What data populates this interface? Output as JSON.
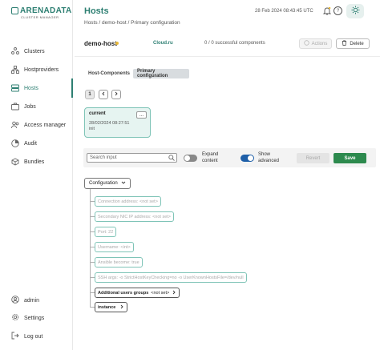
{
  "brand": {
    "name": "ARENADATA",
    "subtitle": "CLUSTER MANAGER"
  },
  "sidebar": {
    "items": [
      {
        "label": "Clusters",
        "icon": "clusters-icon"
      },
      {
        "label": "Hostproviders",
        "icon": "hostproviders-icon"
      },
      {
        "label": "Hosts",
        "icon": "hosts-icon"
      },
      {
        "label": "Jobs",
        "icon": "jobs-icon"
      },
      {
        "label": "Access manager",
        "icon": "access-manager-icon"
      },
      {
        "label": "Audit",
        "icon": "audit-icon"
      },
      {
        "label": "Bundles",
        "icon": "bundles-icon"
      }
    ],
    "bottom": [
      {
        "label": "admin",
        "icon": "user-icon"
      },
      {
        "label": "Settings",
        "icon": "settings-icon"
      },
      {
        "label": "Log out",
        "icon": "logout-icon"
      }
    ]
  },
  "header": {
    "title": "Hosts",
    "breadcrumb": "Hosts / demo-host / Primary configuration",
    "datetime": "28 Feb 2024  08:43:45  UTC"
  },
  "host": {
    "name": "demo-host",
    "cluster": "Cloud.ru",
    "components": "0 / 0 successful components",
    "actions_label": "Actions",
    "delete_label": "Delete"
  },
  "tabs": [
    {
      "label": "Host-Components"
    },
    {
      "label": "Primary configuration"
    }
  ],
  "pagination": {
    "current": "1"
  },
  "config": {
    "label": "current",
    "date": "28/02/2024 08:27:51",
    "description": "init",
    "more": "..."
  },
  "toolbar": {
    "search_placeholder": "Search input",
    "expand_label_1": "Expand",
    "expand_label_2": "content",
    "advanced_label_1": "Show",
    "advanced_label_2": "advanced",
    "revert_label": "Revert",
    "save_label": "Save"
  },
  "tree": {
    "root_label": "Configuration",
    "items": [
      {
        "text": "Connection address: <not set>"
      },
      {
        "text": "Secondary NIC IP address: <not set>"
      },
      {
        "text": "Port: 22"
      },
      {
        "text": "Username: <int>"
      },
      {
        "text": "Ansible become: true"
      },
      {
        "text": "SSH args: -o StrictHostKeyChecking=no -o UserKnownHostsFile=/dev/null"
      }
    ],
    "groups_label": "Additional users groups",
    "groups_value": "<not set>",
    "instance_label": "instance"
  }
}
